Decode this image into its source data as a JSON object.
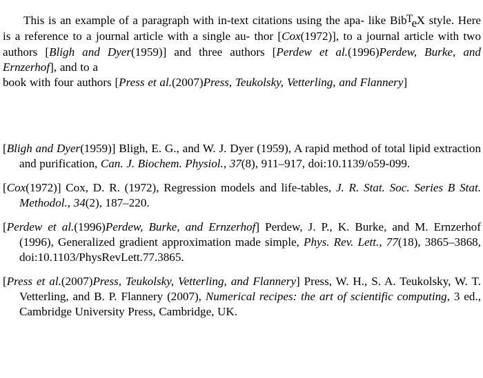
{
  "document": {
    "background_color": "#ffffff",
    "text_color": "#000000"
  },
  "paragraph": {
    "line1": "This is an example of a paragraph with in-text citations using the apa-",
    "line2_a": "like Bib",
    "line2_T": "T",
    "line2_e": "e",
    "line2_X": "X",
    "line2_b": " style.  Here is a reference to a journal article with a single au-",
    "line3_a": "thor [",
    "line3_cite": "Cox",
    "line3_b": "(1972)], to a journal article with two authors [",
    "line3_cite2": "Bligh and Dyer",
    "line3_c": "(1959)]",
    "line4_a": "and three authors [",
    "line4_cite": "Perdew et al.",
    "line4_b": "(1996)",
    "line4_cite2": "Perdew, Burke, and Ernzerhof",
    "line4_c": "], and to a",
    "line5_a": "book with four authors [",
    "line5_cite": "Press et al.",
    "line5_b": "(2007)",
    "line5_cite2": "Press, Teukolsky, Vetterling, and Flannery",
    "line5_c": "]"
  },
  "bibliography": {
    "entries": [
      {
        "label_open": "[",
        "label_authors": "Bligh and Dyer",
        "label_year": "(1959)]",
        "authors": " Bligh, E. G., and W. J. Dyer (1959), A rapid method of total lipid extraction and purification, ",
        "journal": "Can. J. Biochem. Physiol.",
        "journal_sep": ", ",
        "volume": "37",
        "issue": "(8)",
        "pages": ", 911–917, ",
        "doi": "doi:10.1139/o59-099."
      },
      {
        "label_open": "[",
        "label_authors": "Cox",
        "label_year": "(1972)]",
        "authors": " Cox, D. R. (1972), Regression models and life-tables, ",
        "journal": "J. R. Stat. Soc. Series B Stat. Methodol.",
        "journal_sep": ", ",
        "volume": "34",
        "issue": "(2)",
        "pages": ", 187–220.",
        "doi": ""
      },
      {
        "label_open": "[",
        "label_authors": "Perdew et al.",
        "label_year_rm": "(1996)",
        "label_authors2": "Perdew, Burke, and Ernzerhof",
        "label_close": "]",
        "authors": " Perdew, J. P., K. Burke, and M. Ernzerhof (1996), Generalized gradient approximation made simple, ",
        "journal": "Phys. Rev. Lett.",
        "journal_sep": ", ",
        "volume": "77",
        "issue": "(18)",
        "pages": ", 3865–3868, ",
        "doi": "doi:10.1103/PhysRevLett.77.3865."
      },
      {
        "label_open": "[",
        "label_authors": "Press et al.",
        "label_year_rm": "(2007)",
        "label_authors2": "Press, Teukolsky, Vetterling, and Flannery",
        "label_close": "]",
        "authors": " Press, W. H., S. A. Teukolsky, W. T. Vetterling, and B. P. Flannery (2007), ",
        "title": "Numerical recipes: the art of scientific computing",
        "rest": ", 3 ed., Cambridge University Press, Cambridge, UK."
      }
    ]
  }
}
